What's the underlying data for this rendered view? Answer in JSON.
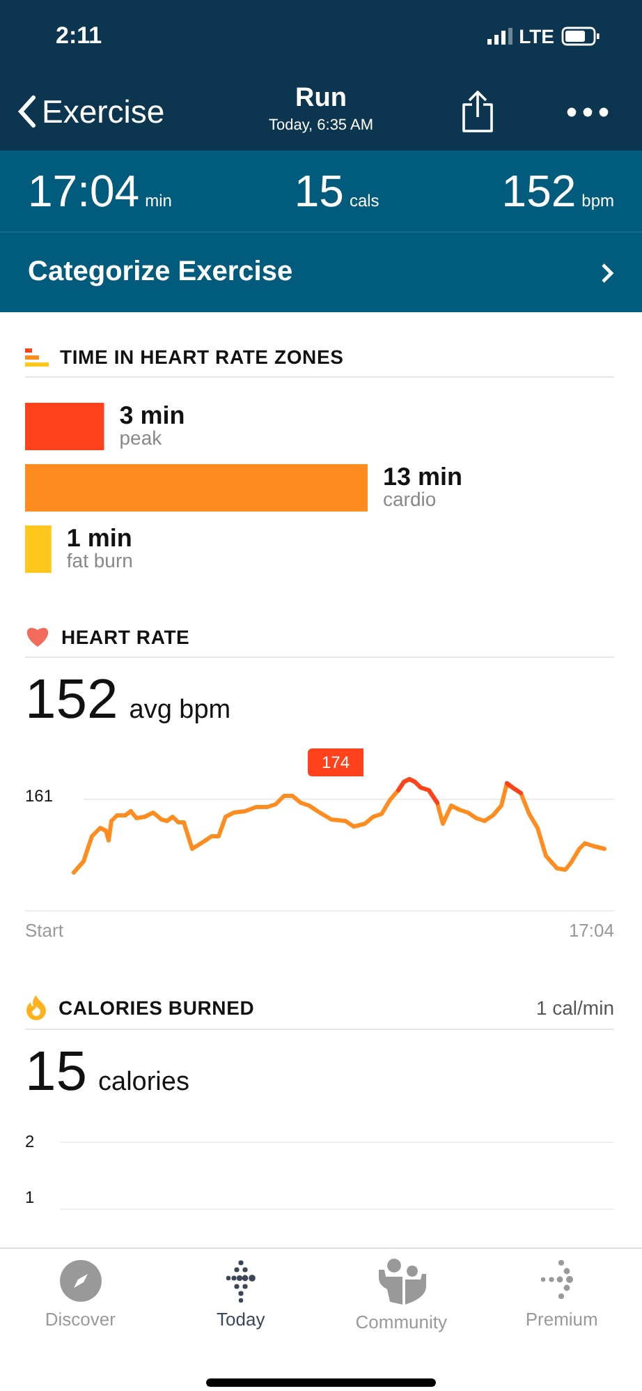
{
  "status_bar": {
    "time": "2:11",
    "network": "LTE"
  },
  "nav": {
    "back": "Exercise",
    "title": "Run",
    "subtitle": "Today, 6:35 AM"
  },
  "stats": [
    {
      "value": "17:04",
      "unit": "min"
    },
    {
      "value": "15",
      "unit": "cals"
    },
    {
      "value": "152",
      "unit": "bpm"
    }
  ],
  "categorize": {
    "label": "Categorize Exercise"
  },
  "zones": {
    "title": "TIME IN HEART RATE ZONES",
    "chart_data": {
      "type": "bar",
      "orientation": "horizontal",
      "series": [
        {
          "name": "peak",
          "color": "#ff421b",
          "values": [
            3
          ]
        },
        {
          "name": "cardio",
          "color": "#ff8c1e",
          "values": [
            13
          ]
        },
        {
          "name": "fat burn",
          "color": "#ffc81e",
          "values": [
            1
          ]
        }
      ],
      "data_labels": true
    },
    "value_units": [
      "min",
      "min",
      "min"
    ]
  },
  "heart_rate": {
    "title": "HEART RATE",
    "value": "152",
    "unit": "avg bpm",
    "y_tick": "161",
    "peak_label": "174",
    "x_start": "Start",
    "x_end": "17:04"
  },
  "calories": {
    "title": "CALORIES BURNED",
    "rate": "1 cal/min",
    "value": "15",
    "unit": "calories",
    "y_ticks": [
      "2",
      "1"
    ]
  },
  "tabs": [
    {
      "label": "Discover",
      "selected": false,
      "kind": "compass"
    },
    {
      "label": "Today",
      "selected": true,
      "kind": "dots"
    },
    {
      "label": "Community",
      "selected": false,
      "kind": "people"
    },
    {
      "label": "Premium",
      "selected": false,
      "kind": "arrow"
    }
  ]
}
